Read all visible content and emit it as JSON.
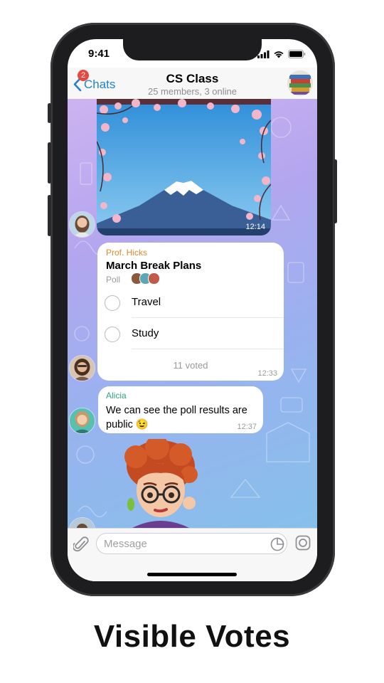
{
  "status_bar": {
    "time": "9:41"
  },
  "header": {
    "back_label": "Chats",
    "unread_badge": "2",
    "title": "CS Class",
    "subtitle": "25 members, 3 online"
  },
  "messages": {
    "photo": {
      "time": "12:14"
    },
    "poll": {
      "sender": "Prof. Hicks",
      "question": "March Break Plans",
      "type_label": "Poll",
      "options": [
        {
          "label": "Travel"
        },
        {
          "label": "Study"
        }
      ],
      "voted_label": "11 voted",
      "time": "12:33"
    },
    "text_message": {
      "sender": "Alicia",
      "text": "We can see the poll results are public 😉",
      "time": "12:37"
    }
  },
  "input": {
    "placeholder": "Message"
  },
  "caption": "Visible Votes",
  "colors": {
    "accent": "#2481cc",
    "badge": "#e8483d",
    "poll_sender": "#e08a2d",
    "alicia_sender": "#2fa67c"
  },
  "icons": [
    "back-chevron-icon",
    "signal-icon",
    "wifi-icon",
    "battery-icon",
    "paperclip-icon",
    "sticker-icon",
    "camera-icon"
  ]
}
